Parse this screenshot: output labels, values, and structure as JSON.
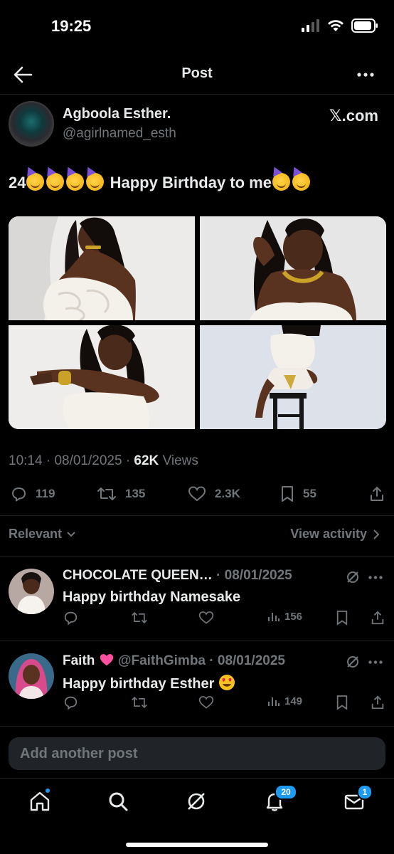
{
  "status_bar": {
    "time": "19:25"
  },
  "nav": {
    "title": "Post"
  },
  "post": {
    "author_name": "Agboola Esther.",
    "author_handle": "@agirlnamed_esth",
    "source_label": "𝕏.com",
    "text_prefix": "24",
    "text_body": "Happy Birthday to me",
    "time": "10:14",
    "date": "08/01/2025",
    "views_count": "62K",
    "views_label": "Views"
  },
  "actions": {
    "replies": "119",
    "reposts": "135",
    "likes": "2.3K",
    "bookmarks": "55"
  },
  "sort": {
    "relevant_label": "Relevant",
    "view_activity_label": "View activity"
  },
  "replies": [
    {
      "name": "CHOCOLATE QUEEN…",
      "separator": "·",
      "date": "08/01/2025",
      "text": "Happy birthday Namesake",
      "views": "156"
    },
    {
      "name": "Faith",
      "handle": "@FaithGimba",
      "separator": "·",
      "date": "08/01/2025",
      "text": "Happy birthday Esther",
      "views": "149"
    }
  ],
  "compose": {
    "placeholder": "Add another post"
  },
  "tabbar": {
    "notifications_badge": "20",
    "messages_badge": "1"
  },
  "colors": {
    "background": "#000000",
    "text": "#e7e9ea",
    "muted": "#71767b",
    "accent": "#1d9bf0"
  }
}
